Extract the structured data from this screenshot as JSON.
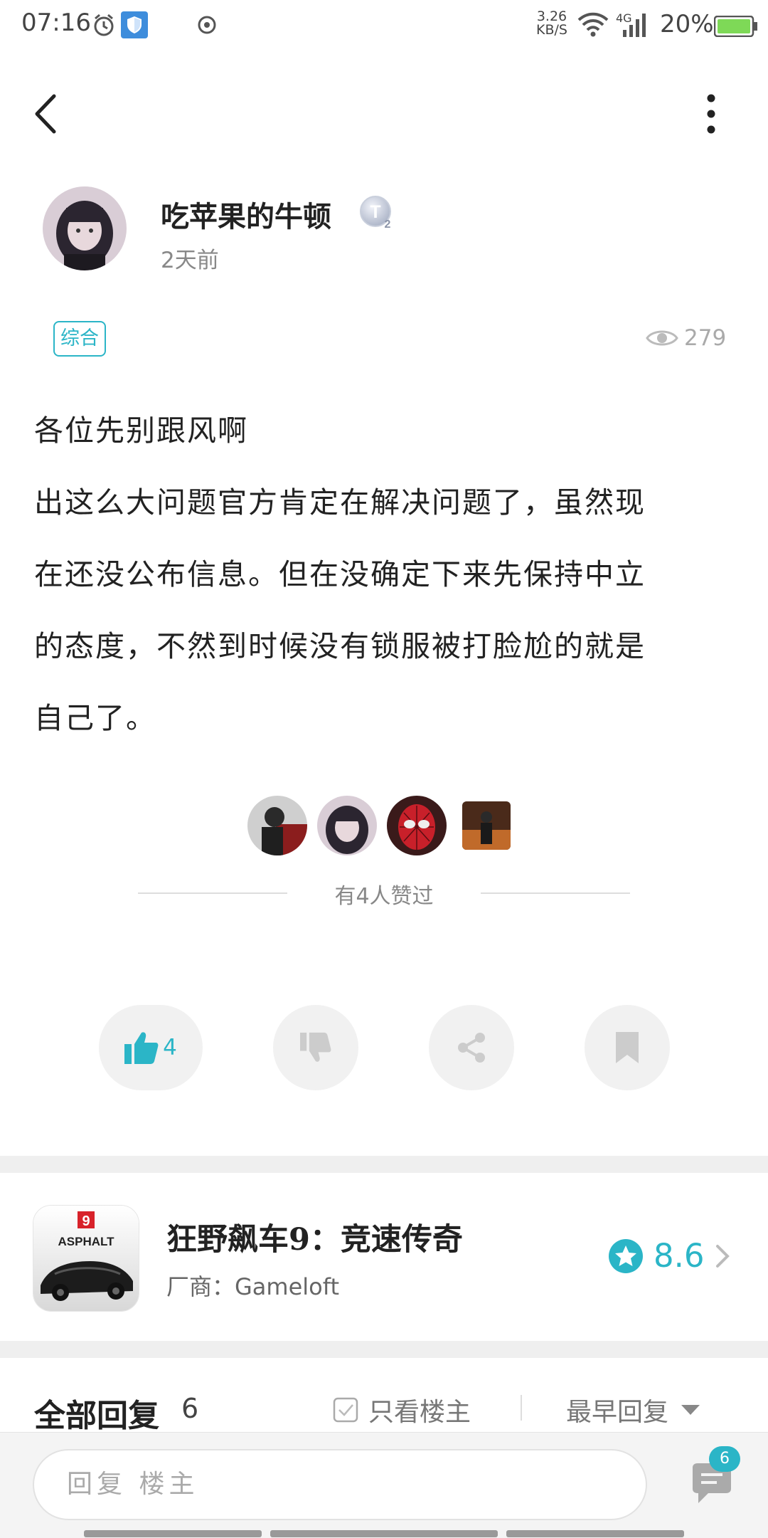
{
  "status_bar": {
    "time": "07:16",
    "net_speed_value": "3.26",
    "net_speed_unit": "KB/S",
    "network": "4G",
    "battery": "20%",
    "icons": [
      "alarm-icon",
      "shield-icon",
      "location-icon",
      "wifi-icon",
      "signal-icon",
      "battery-icon"
    ]
  },
  "post": {
    "author": "吃苹果的牛顿",
    "level_badge": "T2",
    "time_ago": "2天前",
    "tag": "综合",
    "views": "279",
    "content_lines": [
      "各位先别跟风啊",
      "出这么大问题官方肯定在解决问题了，虽然现",
      "在还没公布信息。但在没确定下来先保持中立",
      "的态度，不然到时候没有锁服被打脸尬的就是",
      "自己了。"
    ],
    "likers_text": "有4人赞过",
    "like_count": "4"
  },
  "game": {
    "title": "狂野飙车9：竞速传奇",
    "vendor": "厂商：Gameloft",
    "icon_text": "ASPHALT",
    "icon_num": "9",
    "rating": "8.6"
  },
  "replies": {
    "title": "全部回复",
    "count": "6",
    "only_op": "只看楼主",
    "sort": "最早回复"
  },
  "bottom": {
    "input_placeholder": "回复  楼主",
    "comment_badge": "6"
  },
  "colors": {
    "accent": "#2bb5c7",
    "like_button_bg": "#f1f1f1",
    "divider": "#efefef"
  }
}
